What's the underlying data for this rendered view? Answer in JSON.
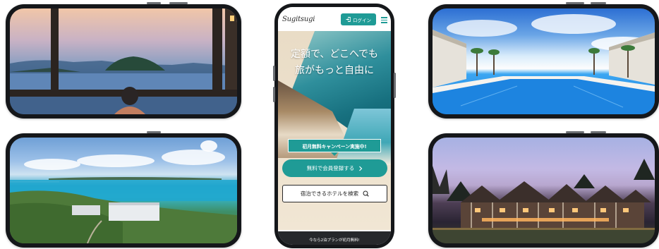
{
  "site": {
    "logo_text": "Sugitsugi",
    "login_label": "ログイン",
    "login_icon": "login-icon",
    "menu_icon": "hamburger-icon",
    "hero_line1": "定額で、どこへでも",
    "hero_line2": "旅がもっと自由に",
    "campaign_badge": "初月無料キャンペーン実施中!",
    "register_button": "無料で会員登録する",
    "register_icon": "chevron-right-icon",
    "search_button": "宿泊できるホテルを検索",
    "search_icon": "search-icon",
    "promo_banner": "今なら2泊プランが初月無料!"
  },
  "photos": {
    "top_left": "hot-spring-sunset",
    "bottom_left": "island-resort-aerial",
    "top_right": "infinity-pool",
    "bottom_right": "mountain-chalet-dusk"
  },
  "colors": {
    "accent": "#1f9b96",
    "frame": "#15171a"
  }
}
